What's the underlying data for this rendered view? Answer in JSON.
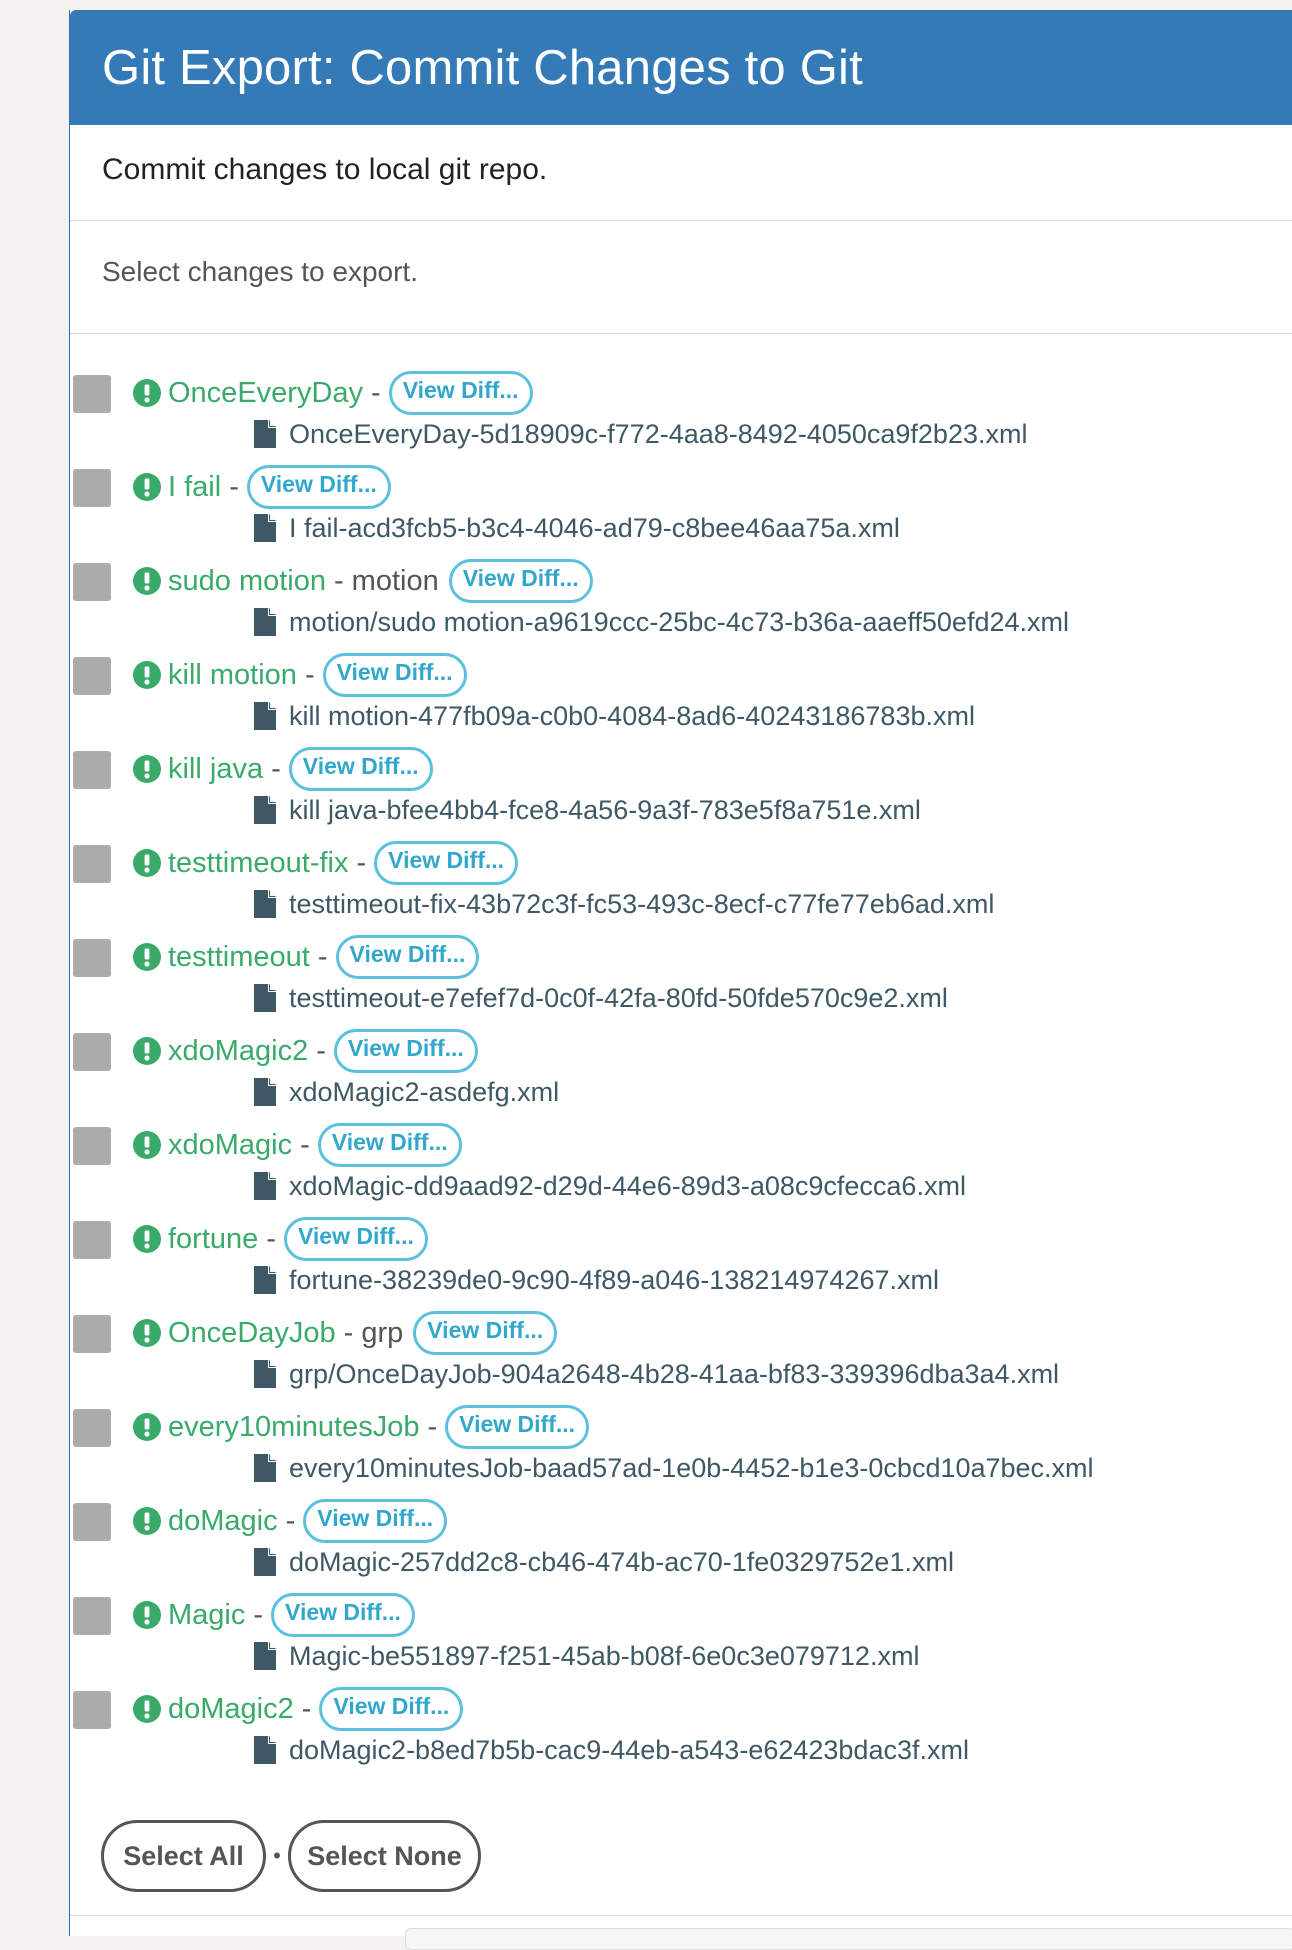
{
  "panel": {
    "title": "Git Export: Commit Changes to Git",
    "subtitle": "Commit changes to local git repo.",
    "instructions": "Select changes to export."
  },
  "sep": "-",
  "view_diff_label": "View Diff...",
  "items": [
    {
      "name": "OnceEveryDay",
      "group": "",
      "file": "OnceEveryDay-5d18909c-f772-4aa8-8492-4050ca9f2b23.xml"
    },
    {
      "name": "I fail",
      "group": "",
      "file": "I fail-acd3fcb5-b3c4-4046-ad79-c8bee46aa75a.xml"
    },
    {
      "name": "sudo motion",
      "group": "motion",
      "file": "motion/sudo motion-a9619ccc-25bc-4c73-b36a-aaeff50efd24.xml"
    },
    {
      "name": "kill motion",
      "group": "",
      "file": "kill motion-477fb09a-c0b0-4084-8ad6-40243186783b.xml"
    },
    {
      "name": "kill java",
      "group": "",
      "file": "kill java-bfee4bb4-fce8-4a56-9a3f-783e5f8a751e.xml"
    },
    {
      "name": "testtimeout-fix",
      "group": "",
      "file": "testtimeout-fix-43b72c3f-fc53-493c-8ecf-c77fe77eb6ad.xml"
    },
    {
      "name": "testtimeout",
      "group": "",
      "file": "testtimeout-e7efef7d-0c0f-42fa-80fd-50fde570c9e2.xml"
    },
    {
      "name": "xdoMagic2",
      "group": "",
      "file": "xdoMagic2-asdefg.xml"
    },
    {
      "name": "xdoMagic",
      "group": "",
      "file": "xdoMagic-dd9aad92-d29d-44e6-89d3-a08c9cfecca6.xml"
    },
    {
      "name": "fortune",
      "group": "",
      "file": "fortune-38239de0-9c90-4f89-a046-138214974267.xml"
    },
    {
      "name": "OnceDayJob",
      "group": "grp",
      "file": "grp/OnceDayJob-904a2648-4b28-41aa-bf83-339396dba3a4.xml"
    },
    {
      "name": "every10minutesJob",
      "group": "",
      "file": "every10minutesJob-baad57ad-1e0b-4452-b1e3-0cbcd10a7bec.xml"
    },
    {
      "name": "doMagic",
      "group": "",
      "file": "doMagic-257dd2c8-cb46-474b-ac70-1fe0329752e1.xml"
    },
    {
      "name": "Magic",
      "group": "",
      "file": "Magic-be551897-f251-45ab-b08f-6e0c3e079712.xml"
    },
    {
      "name": "doMagic2",
      "group": "",
      "file": "doMagic2-b8ed7b5b-cac9-44eb-a543-e62423bdac3f.xml"
    }
  ],
  "actions": {
    "select_all": "Select All",
    "separator": "•",
    "select_none": "Select None"
  },
  "icons": {
    "alert": "exclamation-circle-icon",
    "file": "file-icon"
  },
  "colors": {
    "header_bg": "#337ab7",
    "job_name": "#3aaa6a",
    "diff_button": "#5bc0de",
    "checkbox": "#ababab"
  }
}
